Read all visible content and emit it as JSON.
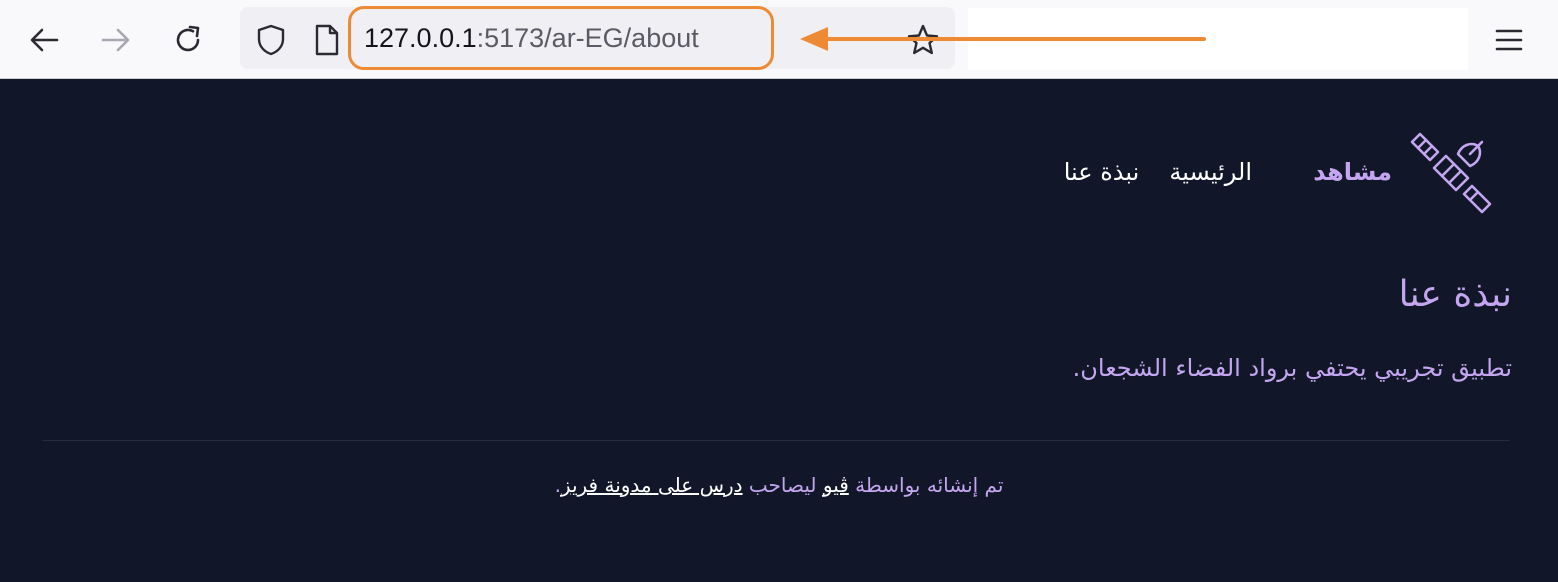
{
  "browser": {
    "url_host": "127.0.0.1",
    "url_path": ":5173/ar-EG/about",
    "annotation_color": "#ef8a34",
    "icons": {
      "back": "back-arrow-icon",
      "forward": "forward-arrow-icon",
      "reload": "reload-icon",
      "shield": "shield-icon",
      "page": "page-icon",
      "bookmark": "star-icon",
      "menu": "hamburger-menu-icon"
    }
  },
  "site": {
    "name": "مشاهد",
    "logo_icon": "satellite-icon",
    "nav": [
      {
        "label": "الرئيسية"
      },
      {
        "label": "نبذة عنا"
      }
    ]
  },
  "main": {
    "title": "نبذة عنا",
    "lead": "تطبيق تجريبي يحتفي برواد الفضاء الشجعان."
  },
  "footer": {
    "prefix": "تم إنشائه بواسطة",
    "link1": "ڤيو",
    "middle": "ليصاحب",
    "link2": "درس على مدونة فريز",
    "suffix": "."
  },
  "colors": {
    "page_background": "#111628",
    "accent": "#c4a6f0",
    "nav_text": "#ffffff"
  }
}
